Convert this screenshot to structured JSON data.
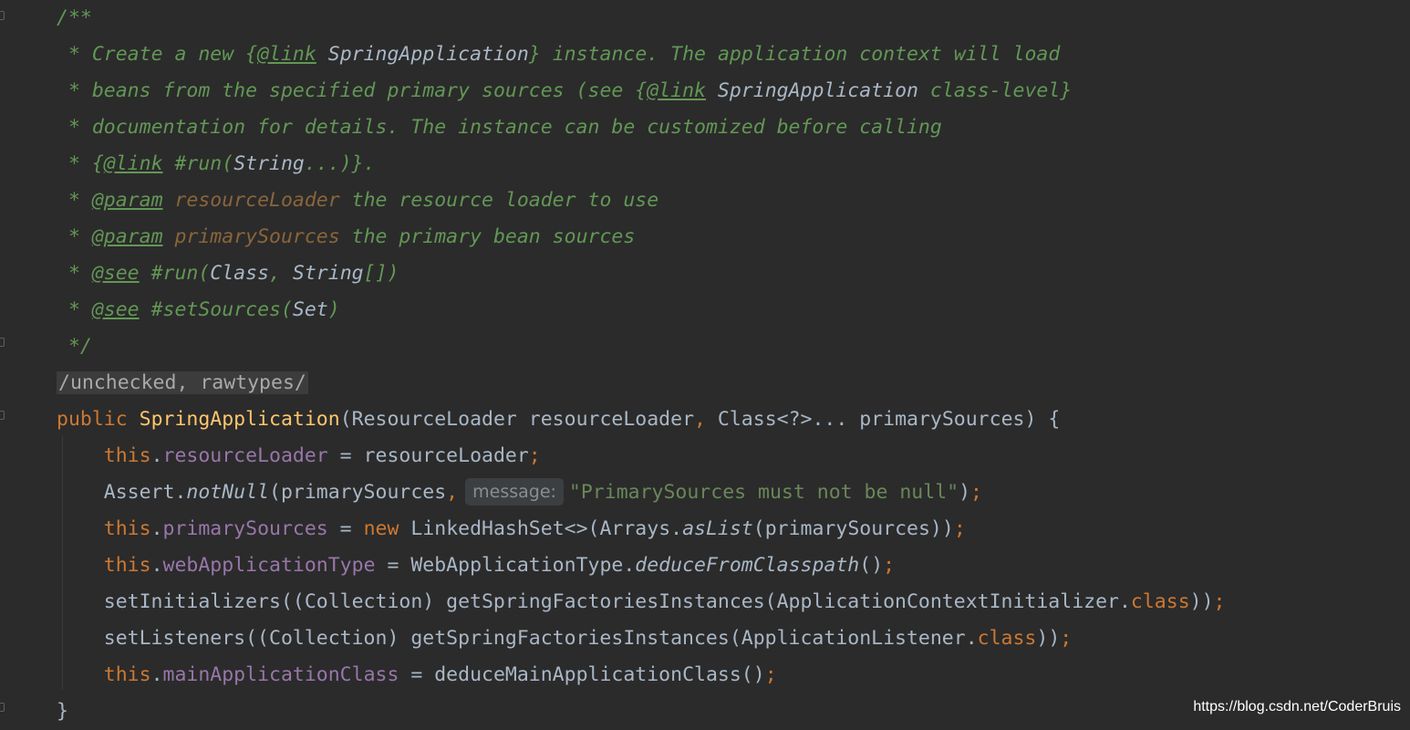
{
  "editor": {
    "colors": {
      "background": "#2b2b2b",
      "default": "#a9b7c6",
      "doc_comment": "#629755",
      "doc_param_name": "#8a653b",
      "keyword": "#cc7832",
      "method_declaration": "#ffc66d",
      "field": "#9876aa",
      "string": "#6a8759"
    },
    "doc": {
      "open": "/**",
      "l1": {
        "star": " * ",
        "t1": "Create a new ",
        "brace_open": "{",
        "link_tag": "@link",
        "sp": " ",
        "ref": "SpringApplication",
        "brace_close": "}",
        "t2": " instance. The application context will load"
      },
      "l2": {
        "star": " * ",
        "t1": "beans from the specified primary sources (see ",
        "brace_open": "{",
        "link_tag": "@link",
        "sp": " ",
        "ref": "SpringApplication",
        "t2": " class-level}"
      },
      "l3": {
        "star": " * ",
        "t1": "documentation for details. The instance can be customized before calling"
      },
      "l4": {
        "star": " * ",
        "brace_open": "{",
        "link_tag": "@link",
        "t1": " #run(",
        "ref": "String",
        "t2": "...)}."
      },
      "l5": {
        "star": " * ",
        "tag": "@param",
        "sp": " ",
        "name": "resourceLoader",
        "t1": " the resource loader to use"
      },
      "l6": {
        "star": " * ",
        "tag": "@param",
        "sp": " ",
        "name": "primarySources",
        "t1": " the primary bean sources"
      },
      "l7": {
        "star": " * ",
        "tag": "@see",
        "t1": " #run(",
        "ref1": "Class",
        "t2": ", ",
        "ref2": "String",
        "t3": "[])"
      },
      "l8": {
        "star": " * ",
        "tag": "@see",
        "t1": " #setSources(",
        "ref": "Set",
        "t2": ")"
      },
      "close": " */"
    },
    "annotation_line": "/unchecked, rawtypes/",
    "ctor": {
      "kw_public": "public",
      "sp": " ",
      "name": "SpringApplication",
      "rest_a": "(ResourceLoader resourceLoader",
      "comma": ",",
      "rest_b": " Class<?>... primarySources) {"
    },
    "body": {
      "l1": {
        "indent": "    ",
        "this": "this",
        "dot": ".",
        "field": "resourceLoader",
        "t1": " = resourceLoader",
        "semi": ";"
      },
      "l2": {
        "indent": "    ",
        "t1": "Assert.",
        "method": "notNull",
        "t2": "(primarySources",
        "comma": ",",
        "hint": "message:",
        "str": "\"PrimarySources must not be null\"",
        "t3": ")",
        "semi": ";"
      },
      "l3": {
        "indent": "    ",
        "this": "this",
        "dot": ".",
        "field": "primarySources",
        "t1": " = ",
        "kw_new": "new",
        "t2": " LinkedHashSet<>(Arrays.",
        "method": "asList",
        "t3": "(primarySources))",
        "semi": ";"
      },
      "l4": {
        "indent": "    ",
        "this": "this",
        "dot": ".",
        "field": "webApplicationType",
        "t1": " = WebApplicationType.",
        "method": "deduceFromClasspath",
        "t2": "()",
        "semi": ";"
      },
      "l5": {
        "indent": "    ",
        "t1": "setInitializers((Collection) getSpringFactoriesInstances(ApplicationContextInitializer.",
        "kw_class": "class",
        "t2": "))",
        "semi": ";"
      },
      "l6": {
        "indent": "    ",
        "t1": "setListeners((Collection) getSpringFactoriesInstances(ApplicationListener.",
        "kw_class": "class",
        "t2": "))",
        "semi": ";"
      },
      "l7": {
        "indent": "    ",
        "this": "this",
        "dot": ".",
        "field": "mainApplicationClass",
        "t1": " = deduceMainApplicationClass()",
        "semi": ";"
      }
    },
    "close_brace": "}"
  },
  "watermark": "https://blog.csdn.net/CoderBruis"
}
